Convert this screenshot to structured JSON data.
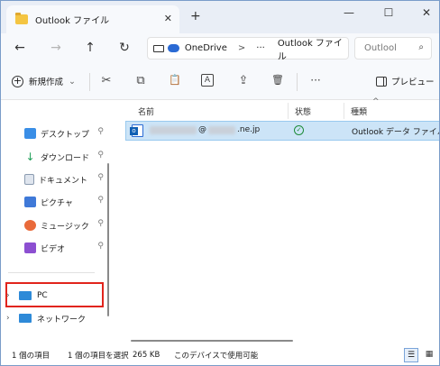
{
  "tab": {
    "title": "Outlook ファイル",
    "close": "✕",
    "new": "+"
  },
  "window_controls": {
    "minimize": "—",
    "maximize": "☐",
    "close": "✕"
  },
  "nav": {
    "back": "←",
    "forward": "→",
    "up": "↑",
    "refresh": "↻"
  },
  "address": {
    "segment1": "OneDrive",
    "sep1": ">",
    "more": "···",
    "segment2": "Outlook ファイル"
  },
  "search": {
    "placeholder": "Outlool",
    "icon": "⌕"
  },
  "toolbar": {
    "new_label": "新規作成",
    "new_chevron": "⌄",
    "more": "···",
    "preview_label": "プレビュー",
    "icons": {
      "cut": "✂",
      "copy": "⧉",
      "paste": "📋",
      "rename": "A",
      "share": "⇪",
      "delete": "🗑"
    }
  },
  "sidebar": {
    "quick": [
      {
        "label": "デスクトップ",
        "color": "#3a8ee6"
      },
      {
        "label": "ダウンロード",
        "color": "#20a05a"
      },
      {
        "label": "ドキュメント",
        "color": "#8b9bb0"
      },
      {
        "label": "ピクチャ",
        "color": "#3f79d8"
      },
      {
        "label": "ミュージック",
        "color": "#e96a3a"
      },
      {
        "label": "ビデオ",
        "color": "#8c4fd1"
      }
    ],
    "pin": "📌",
    "tree": [
      {
        "label": "PC",
        "chevron": "›"
      },
      {
        "label": "ネットワーク",
        "chevron": "›"
      }
    ]
  },
  "columns": {
    "name": "名前",
    "status": "状態",
    "type": "種類",
    "sort": "^"
  },
  "files": [
    {
      "name_suffix": "@",
      "domain_suffix": ".ne.jp",
      "status": "✓",
      "type": "Outlook データ ファイル"
    }
  ],
  "status_bar": {
    "count": "1 個の項目",
    "selected": "1 個の項目を選択",
    "size": "265 KB",
    "location": "このデバイスで使用可能",
    "view_details": "☰",
    "view_tiles": "▦"
  }
}
